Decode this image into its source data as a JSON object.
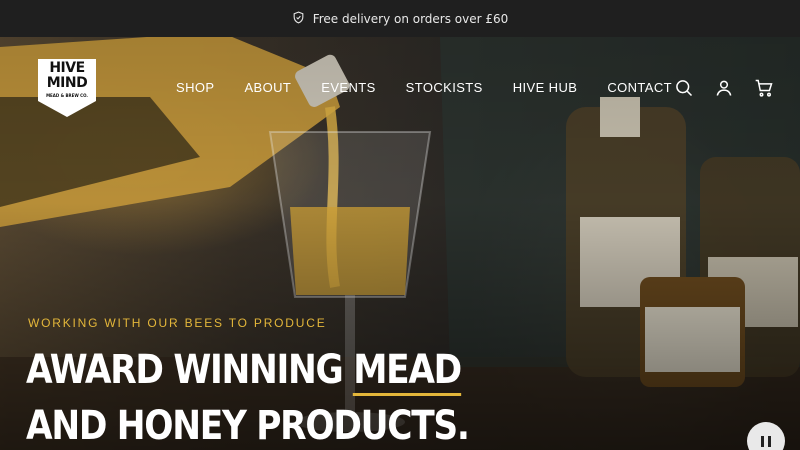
{
  "announcement": {
    "icon": "shield-check-icon",
    "text": "Free delivery on orders over £60"
  },
  "brand": {
    "logo_line1": "HIVE",
    "logo_line2": "MIND",
    "logo_sub": "MEAD & BREW CO."
  },
  "nav": {
    "items": [
      {
        "label": "SHOP"
      },
      {
        "label": "ABOUT"
      },
      {
        "label": "EVENTS"
      },
      {
        "label": "STOCKISTS"
      },
      {
        "label": "HIVE HUB"
      },
      {
        "label": "CONTACT"
      }
    ]
  },
  "header_icons": [
    "search-icon",
    "account-icon",
    "cart-icon"
  ],
  "hero": {
    "eyebrow": "WORKING WITH OUR BEES TO PRODUCE",
    "headline_part1": "AWARD WINNING ",
    "headline_highlight": "MEAD",
    "headline_line2": "AND HONEY PRODUCTS.",
    "accent_color": "#e3b63a"
  },
  "slideshow": {
    "control": "pause-icon"
  }
}
